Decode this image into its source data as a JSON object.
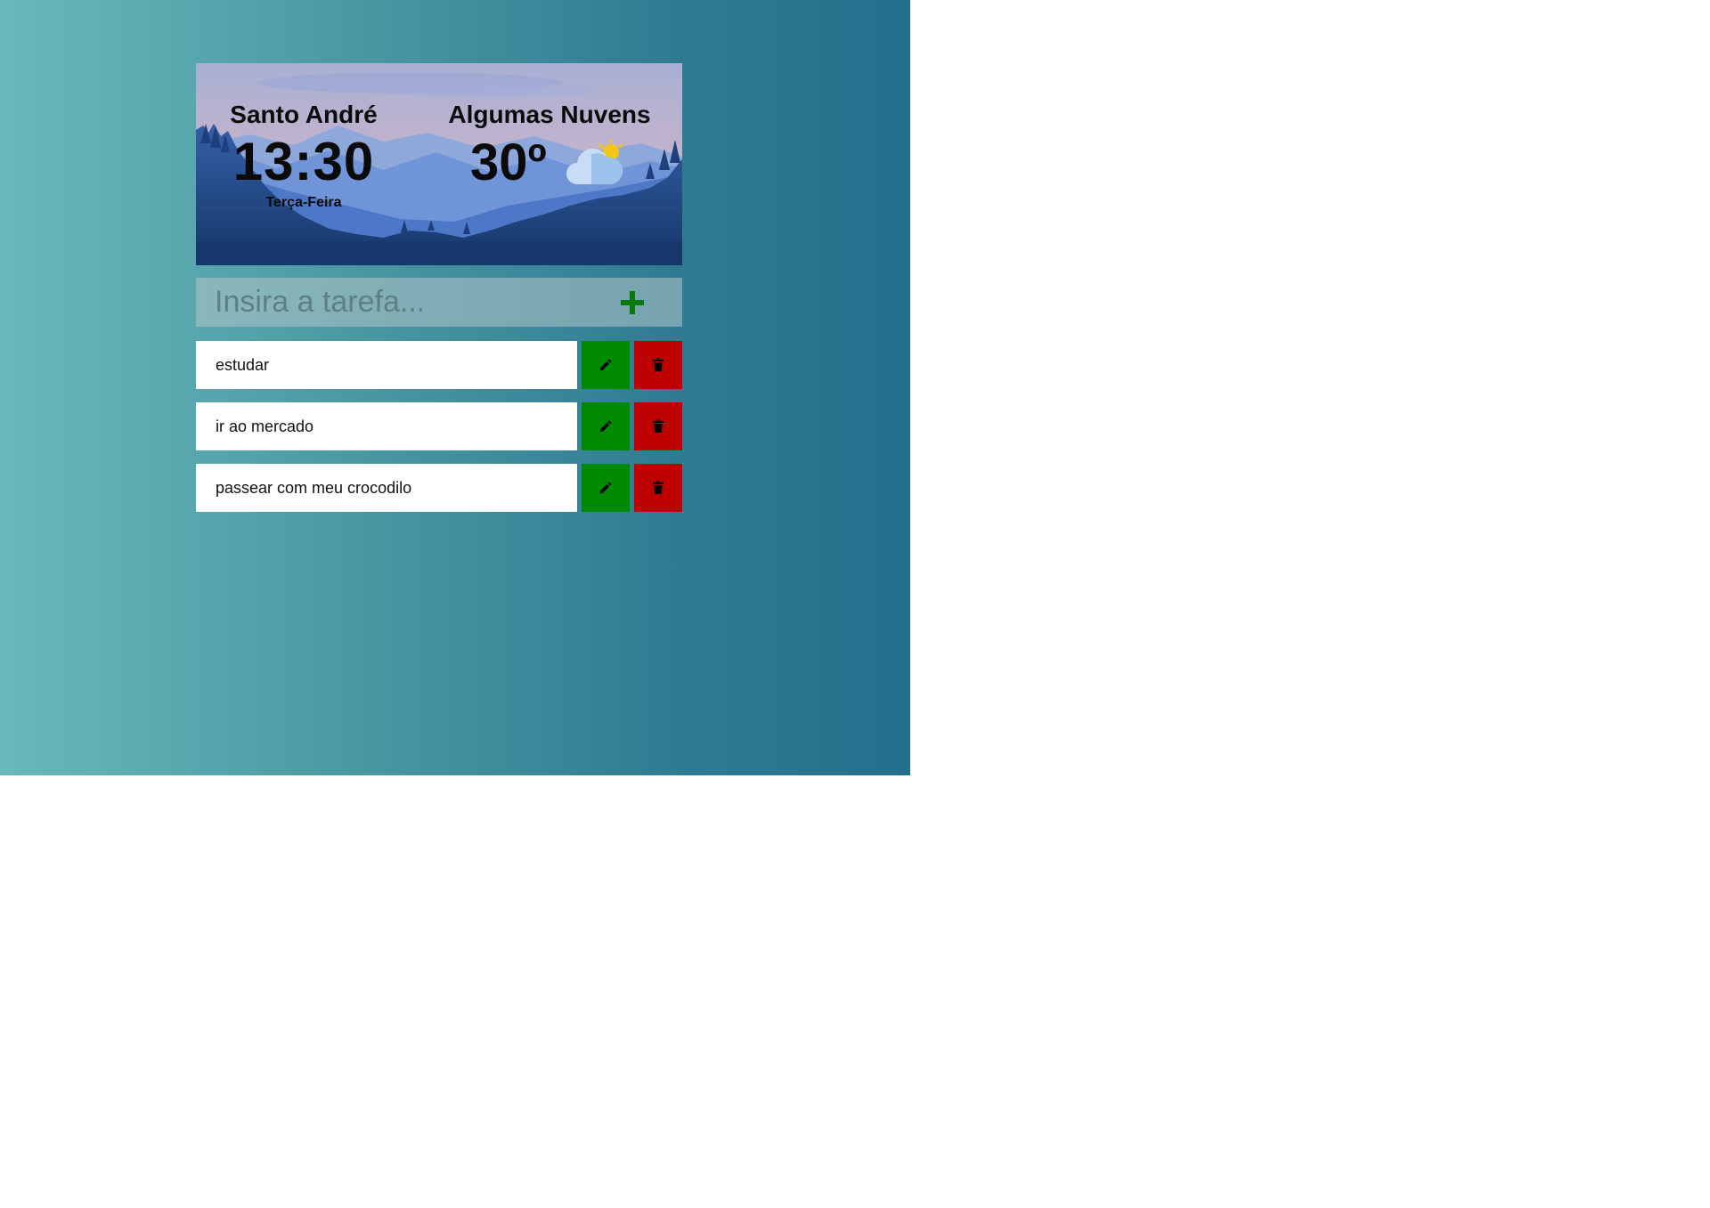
{
  "weather": {
    "city": "Santo André",
    "time": "13:30",
    "weekday": "Terça-Feira",
    "condition": "Algumas Nuvens",
    "temperature": "30º",
    "icon": "partly-cloudy-icon"
  },
  "task_input": {
    "placeholder": "Insira a tarefa...",
    "value": "",
    "add_icon": "plus-icon"
  },
  "tasks": [
    {
      "text": "estudar"
    },
    {
      "text": "ir ao mercado"
    },
    {
      "text": "passear com meu crocodilo"
    }
  ],
  "actions": {
    "edit_icon": "pencil-icon",
    "delete_icon": "trash-icon"
  },
  "colors": {
    "background_left": "#68b9ba",
    "background_right": "#23708c",
    "edit_button": "#008a00",
    "delete_button": "#bd0000",
    "add_icon": "#0a7a0a"
  }
}
